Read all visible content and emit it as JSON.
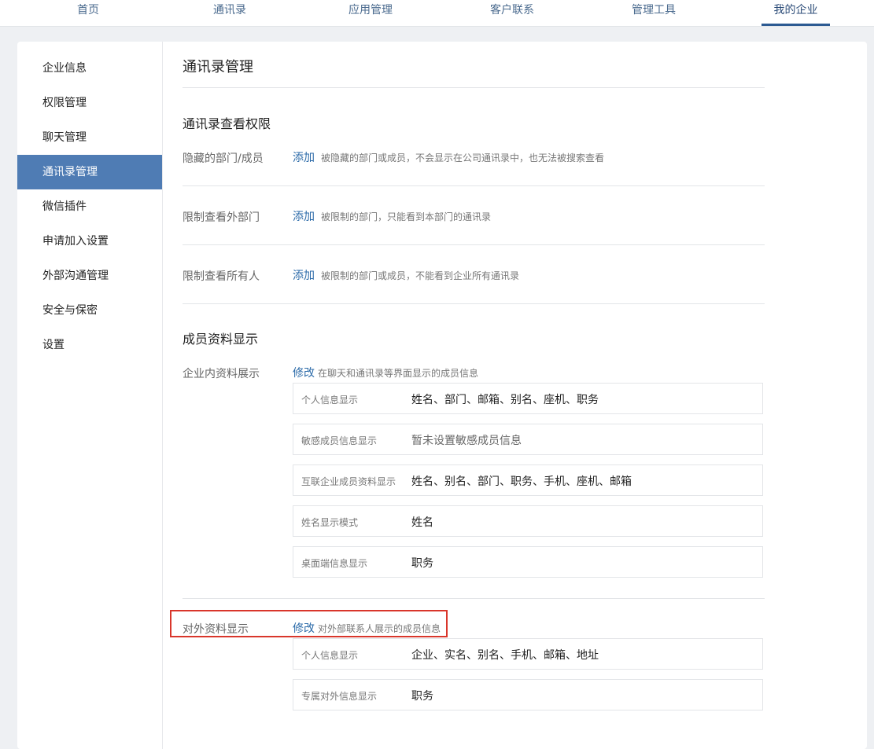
{
  "topnav": {
    "tabs": [
      "首页",
      "通讯录",
      "应用管理",
      "客户联系",
      "管理工具",
      "我的企业"
    ],
    "active": "我的企业"
  },
  "sidebar": {
    "items": [
      "企业信息",
      "权限管理",
      "聊天管理",
      "通讯录管理",
      "微信插件",
      "申请加入设置",
      "外部沟通管理",
      "安全与保密",
      "设置"
    ],
    "active": "通讯录管理"
  },
  "main": {
    "title": "通讯录管理",
    "section1": {
      "title": "通讯录查看权限",
      "rows": [
        {
          "label": "隐藏的部门/成员",
          "action": "添加",
          "desc": "被隐藏的部门或成员，不会显示在公司通讯录中，也无法被搜索查看"
        },
        {
          "label": "限制查看外部门",
          "action": "添加",
          "desc": "被限制的部门，只能看到本部门的通讯录"
        },
        {
          "label": "限制查看所有人",
          "action": "添加",
          "desc": "被限制的部门或成员，不能看到企业所有通讯录"
        }
      ]
    },
    "section2": {
      "title": "成员资料显示",
      "internal": {
        "label": "企业内资料展示",
        "action": "修改",
        "desc": "在聊天和通讯录等界面显示的成员信息",
        "fields": [
          {
            "key": "个人信息显示",
            "value": "姓名、部门、邮箱、别名、座机、职务"
          },
          {
            "key": "敏感成员信息显示",
            "value": "暂未设置敏感成员信息"
          },
          {
            "key": "互联企业成员资料显示",
            "value": "姓名、别名、部门、职务、手机、座机、邮箱"
          },
          {
            "key": "姓名显示模式",
            "value": "姓名"
          },
          {
            "key": "桌面端信息显示",
            "value": "职务"
          }
        ]
      },
      "external": {
        "label": "对外资料显示",
        "action": "修改",
        "desc": "对外部联系人展示的成员信息",
        "fields": [
          {
            "key": "个人信息显示",
            "value": "企业、实名、别名、手机、邮箱、地址"
          },
          {
            "key": "专属对外信息显示",
            "value": "职务"
          }
        ]
      }
    }
  },
  "colors": {
    "accent": "#4f7cb4",
    "link": "#2b6aa8",
    "highlight": "#d9362b"
  }
}
